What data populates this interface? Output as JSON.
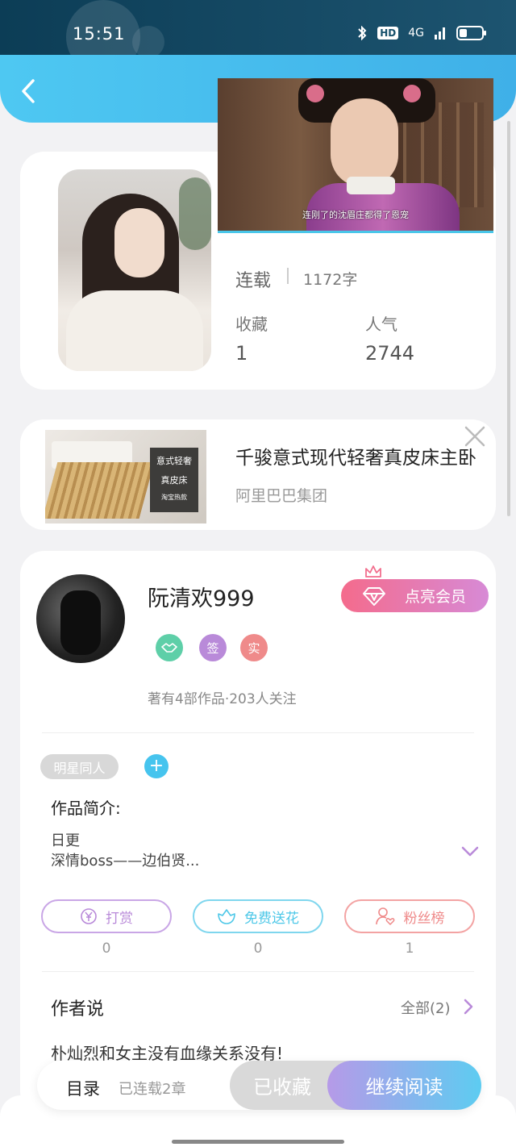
{
  "status_bar": {
    "time": "15:51",
    "network": "4G",
    "hd": "HD"
  },
  "video": {
    "subtitle": "连刚了的沈眉庄都得了恩宠"
  },
  "book": {
    "status": "连载",
    "word_count": "1172字",
    "favorites_label": "收藏",
    "favorites_value": "1",
    "popularity_label": "人气",
    "popularity_value": "2744"
  },
  "ad": {
    "title": "千骏意式现代轻奢真皮床主卧",
    "company": "阿里巴巴集团",
    "image_text_line1": "意式轻奢",
    "image_text_line2": "真皮床",
    "image_text_line3": "淘宝热款"
  },
  "author": {
    "name": "阮清欢999",
    "vip_button": "点亮会员",
    "badges": [
      "签",
      "实"
    ],
    "meta": "著有4部作品·203人关注"
  },
  "tags": {
    "primary": "明星同人",
    "add": "+"
  },
  "intro": {
    "label": "作品简介:",
    "line1": "日更",
    "line2": "深情boss——边伯贤..."
  },
  "actions": [
    {
      "label": "打赏",
      "count": "0",
      "color": "#b98ad9"
    },
    {
      "label": "免费送花",
      "count": "0",
      "color": "#4ec8e8"
    },
    {
      "label": "粉丝榜",
      "count": "1",
      "color": "#ef8a8a"
    }
  ],
  "author_says": {
    "title": "作者说",
    "all_link": "全部(2)",
    "text": "朴灿烈和女主没有血缘关系没有!"
  },
  "bottom": {
    "toc": "目录",
    "serial": "已连载2章",
    "collected": "已收藏",
    "continue": "继续阅读"
  }
}
